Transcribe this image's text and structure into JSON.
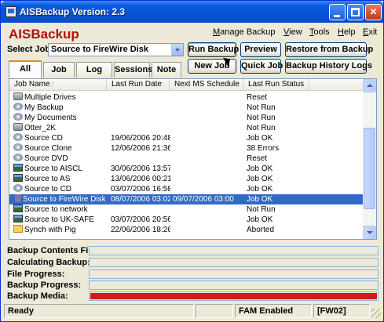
{
  "window": {
    "title": "AISBackup Version: 2.3",
    "minimize": "_",
    "maximize": "□",
    "close": "✕"
  },
  "brand": "AISBackup",
  "menu": [
    "Manage Backup",
    "View",
    "Tools",
    "Help",
    "Exit"
  ],
  "select_job": {
    "label": "Select Job:",
    "value": "Source to FireWire Disk"
  },
  "buttons": {
    "run_backup": "Run Backup",
    "preview": "Preview",
    "restore": "Restore from Backup",
    "new_job": "New Job",
    "quick_job": "Quick Job",
    "history": "Backup History Logs"
  },
  "tabs": [
    "All Jobs",
    "Job",
    "Log",
    "Sessions",
    "Note"
  ],
  "table": {
    "columns": [
      "Job Name",
      "Last Run Date",
      "Next MS Schedule",
      "Last Run Status"
    ],
    "sort_indicator": "⁄",
    "rows": [
      {
        "icon": "drive-icon",
        "name": "Multiple Drives",
        "last_run": "",
        "next": "",
        "status": "Reset"
      },
      {
        "icon": "cd-icon",
        "name": "My Backup",
        "last_run": "",
        "next": "",
        "status": "Not Run"
      },
      {
        "icon": "cd-icon",
        "name": "My Documents",
        "last_run": "",
        "next": "",
        "status": "Not Run"
      },
      {
        "icon": "drive-icon",
        "name": "Otter_2K",
        "last_run": "",
        "next": "",
        "status": "Not Run"
      },
      {
        "icon": "cd-icon",
        "name": "Source CD",
        "last_run": "19/06/2006 20:48",
        "next": "",
        "status": "Job OK"
      },
      {
        "icon": "cd-icon",
        "name": "Source Clone",
        "last_run": "12/06/2006 21:36",
        "next": "",
        "status": "38 Errors"
      },
      {
        "icon": "cd-icon",
        "name": "Source DVD",
        "last_run": "",
        "next": "",
        "status": "Reset"
      },
      {
        "icon": "network-icon",
        "name": "Source to AISCL",
        "last_run": "30/06/2006 13:57",
        "next": "",
        "status": "Job OK"
      },
      {
        "icon": "network-icon",
        "name": "Source to AS",
        "last_run": "13/06/2006 00:21",
        "next": "",
        "status": "Job OK"
      },
      {
        "icon": "cd-icon",
        "name": "Source to CD",
        "last_run": "03/07/2006 16:58",
        "next": "",
        "status": "Job OK"
      },
      {
        "icon": "usb-icon",
        "name": "Source to FireWire Disk",
        "last_run": "08/07/2006 03:02",
        "next": "09/07/2006 03:00",
        "status": "Job OK",
        "selected": true
      },
      {
        "icon": "network-icon",
        "name": "Source to network",
        "last_run": "",
        "next": "",
        "status": "Not Run"
      },
      {
        "icon": "network-icon",
        "name": "Source to UK-SAFE",
        "last_run": "03/07/2006 20:56",
        "next": "",
        "status": "Job OK"
      },
      {
        "icon": "folder-icon",
        "name": "Synch with Pig",
        "last_run": "22/06/2006 18:26",
        "next": "",
        "status": "Aborted"
      }
    ]
  },
  "progress": {
    "contents_file": "Backup Contents File:",
    "calculating": "Calculating Backup:",
    "file_progress": "File Progress:",
    "backup_progress": "Backup Progress:",
    "backup_media": "Backup Media:",
    "media_fill": 1.0,
    "media_color": "#d81818"
  },
  "status": {
    "state": "Ready",
    "fam": "FAM Enabled",
    "drive": "[FW02]"
  }
}
